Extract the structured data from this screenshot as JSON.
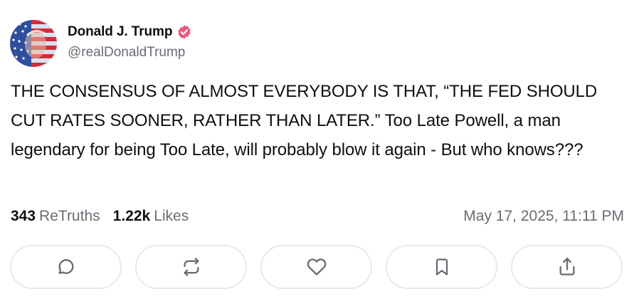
{
  "author": {
    "display_name": "Donald J. Trump",
    "handle": "@realDonaldTrump",
    "avatar_icon": "avatar-flag-portrait",
    "verified_icon": "verified-badge-icon",
    "verified_color": "#e8597c"
  },
  "post": {
    "text": "THE CONSENSUS OF ALMOST EVERYBODY IS THAT, “THE FED SHOULD CUT RATES SOONER, RATHER THAN LATER.” Too Late Powell, a man legendary for being Too Late, will probably blow it again - But who knows???"
  },
  "stats": {
    "retruths_count": "343",
    "retruths_label": "ReTruths",
    "likes_count": "1.22k",
    "likes_label": "Likes",
    "timestamp": "May 17, 2025, 11:11 PM"
  },
  "actions": [
    {
      "name": "reply",
      "icon": "comment-icon"
    },
    {
      "name": "retruth",
      "icon": "repost-icon"
    },
    {
      "name": "like",
      "icon": "heart-icon"
    },
    {
      "name": "bookmark",
      "icon": "bookmark-icon"
    },
    {
      "name": "share",
      "icon": "share-icon"
    }
  ],
  "colors": {
    "text_primary": "#0f0f10",
    "text_secondary": "#6b6b76",
    "button_border": "#e8e8ee"
  }
}
